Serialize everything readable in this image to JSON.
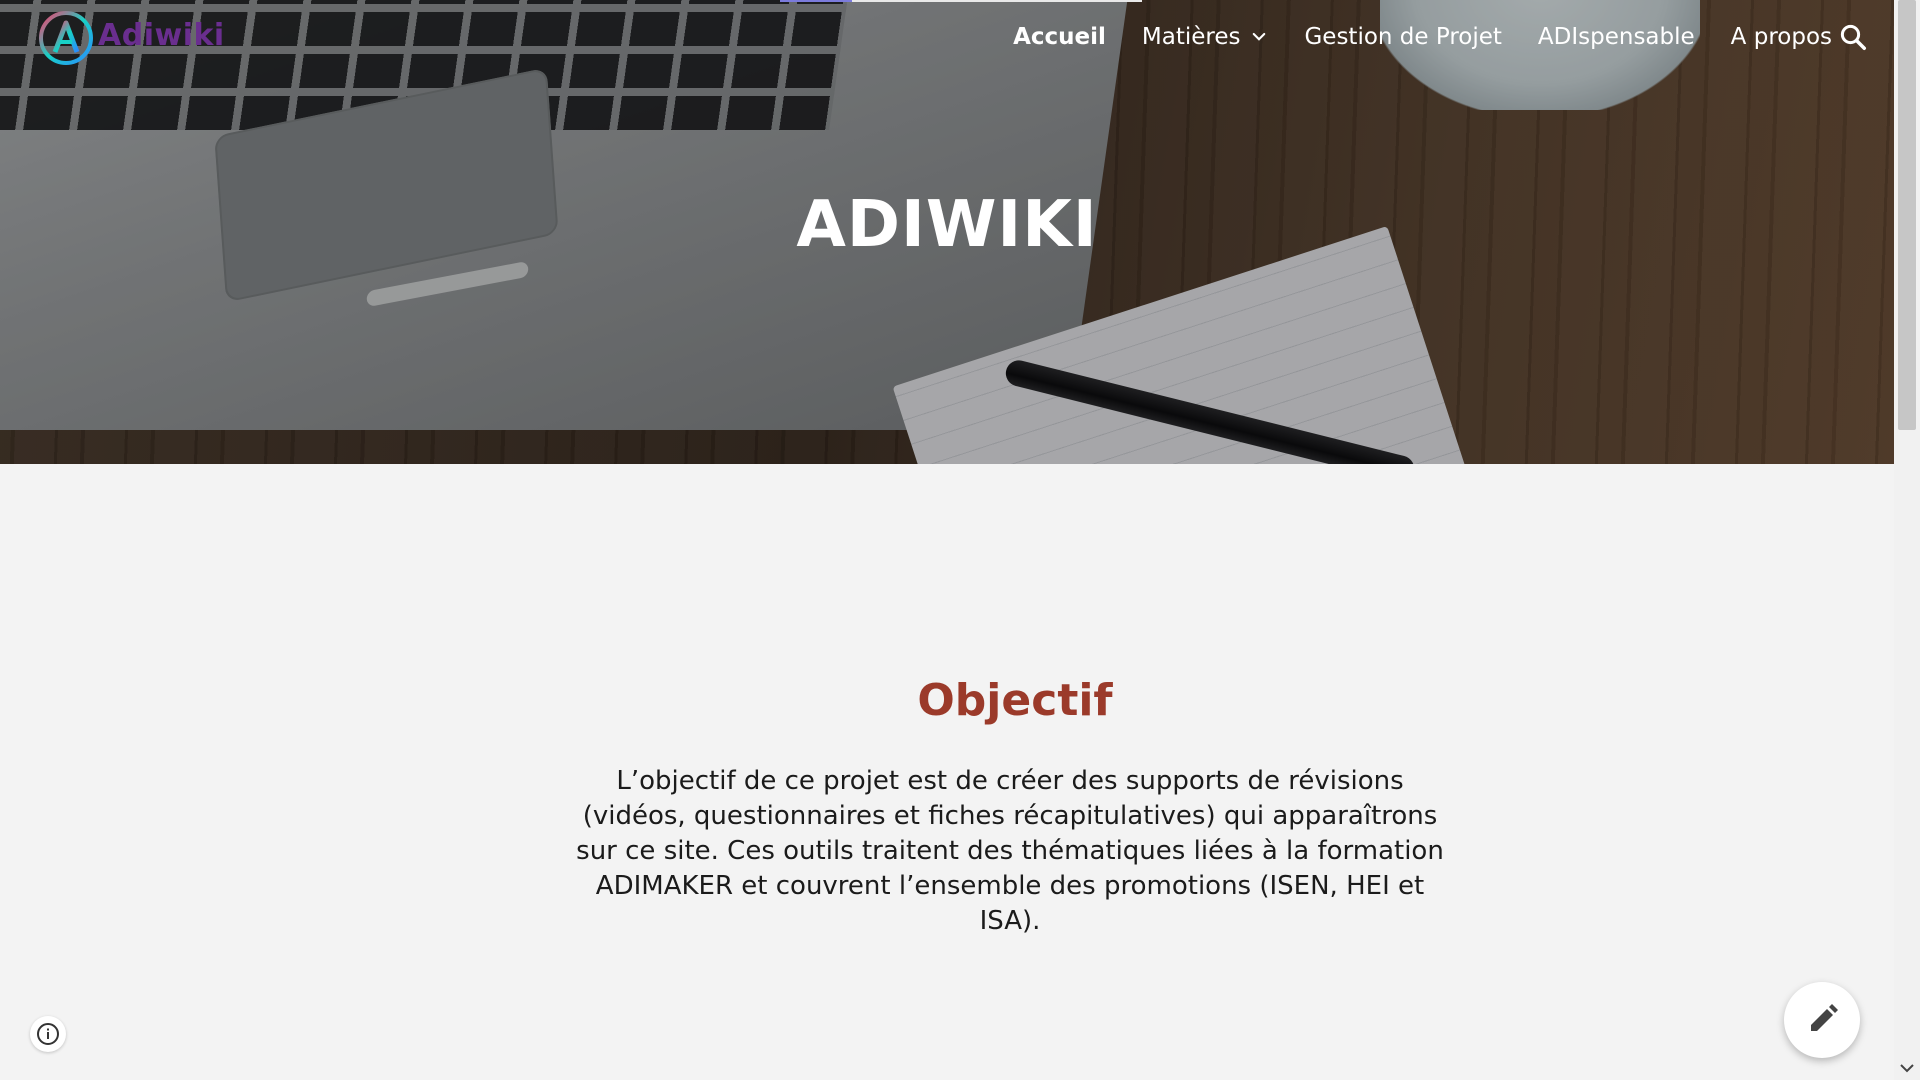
{
  "header": {
    "logo_text": "Adiwiki",
    "nav_items": [
      {
        "label": "Accueil"
      },
      {
        "label": "Matières"
      },
      {
        "label": "Gestion de Projet"
      },
      {
        "label": "ADIspensable"
      },
      {
        "label": "A propos"
      }
    ],
    "loading_progress": 0.2
  },
  "hero": {
    "title": "ADIWIKI"
  },
  "main": {
    "section_title": "Objectif",
    "body": "L’objectif de ce projet est de créer des supports de révisions (vidéos, questionnaires et fiches récapitulatives) qui apparaîtrons sur ce site. Ces outils traitent des thématiques liées à la formation ADIMAKER et couvrent l’ensemble des promotions (ISEN, HEI et ISA)."
  },
  "icons": {
    "logo": "logo-icon",
    "search": "search-icon",
    "chevron": "chevron-down-icon",
    "info": "info-icon",
    "edit": "pencil-icon"
  },
  "colors": {
    "title_accent": "#9b3a2a",
    "logo_text": "#6a2e8f",
    "page_bg": "#f3f3f3"
  }
}
